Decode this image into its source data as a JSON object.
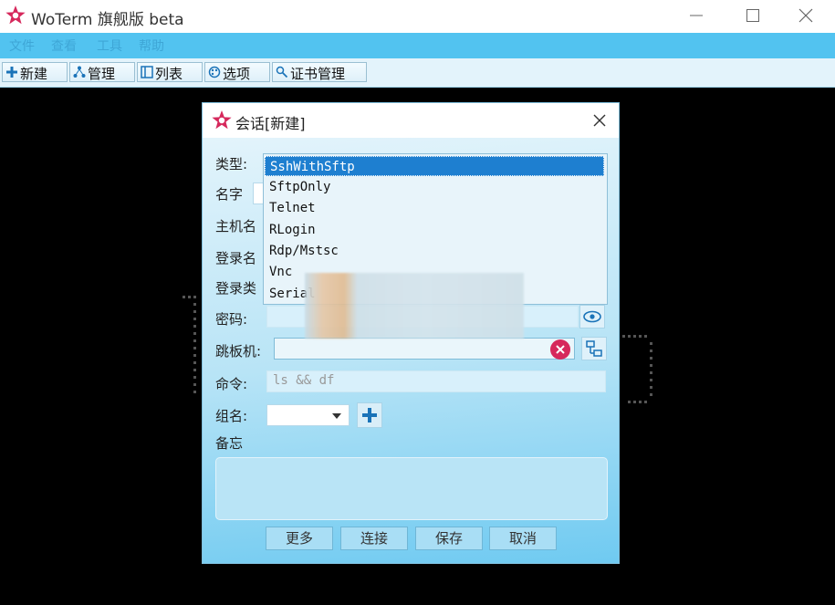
{
  "window": {
    "title": "WoTerm 旗舰版 beta"
  },
  "menubar": {
    "items": [
      "文件",
      "查看",
      "工具",
      "帮助"
    ]
  },
  "toolbar": {
    "items": [
      {
        "label": "新建",
        "icon": "plus-icon"
      },
      {
        "label": "管理",
        "icon": "manage-icon"
      },
      {
        "label": "列表",
        "icon": "list-icon"
      },
      {
        "label": "选项",
        "icon": "options-icon"
      },
      {
        "label": "证书管理",
        "icon": "certificate-icon"
      }
    ]
  },
  "dialog": {
    "title": "会话[新建]",
    "labels": {
      "type": "类型:",
      "name": "名字",
      "host": "主机名",
      "login": "登录名",
      "login_type": "登录类",
      "password": "密码:",
      "jump": "跳板机:",
      "command": "命令:",
      "group": "组名:",
      "memo": "备忘"
    },
    "type_options": [
      "SshWithSftp",
      "SftpOnly",
      "Telnet",
      "RLogin",
      "Rdp/Mstsc",
      "Vnc",
      "Serial"
    ],
    "type_selected": "SshWithSftp",
    "command_placeholder": "ls && df",
    "buttons": {
      "more": "更多",
      "connect": "连接",
      "save": "保存",
      "cancel": "取消"
    }
  },
  "colors": {
    "accent": "#52c3f0",
    "selection": "#1e7fd0",
    "clear": "#d6285c",
    "brand": "#d6285c"
  }
}
